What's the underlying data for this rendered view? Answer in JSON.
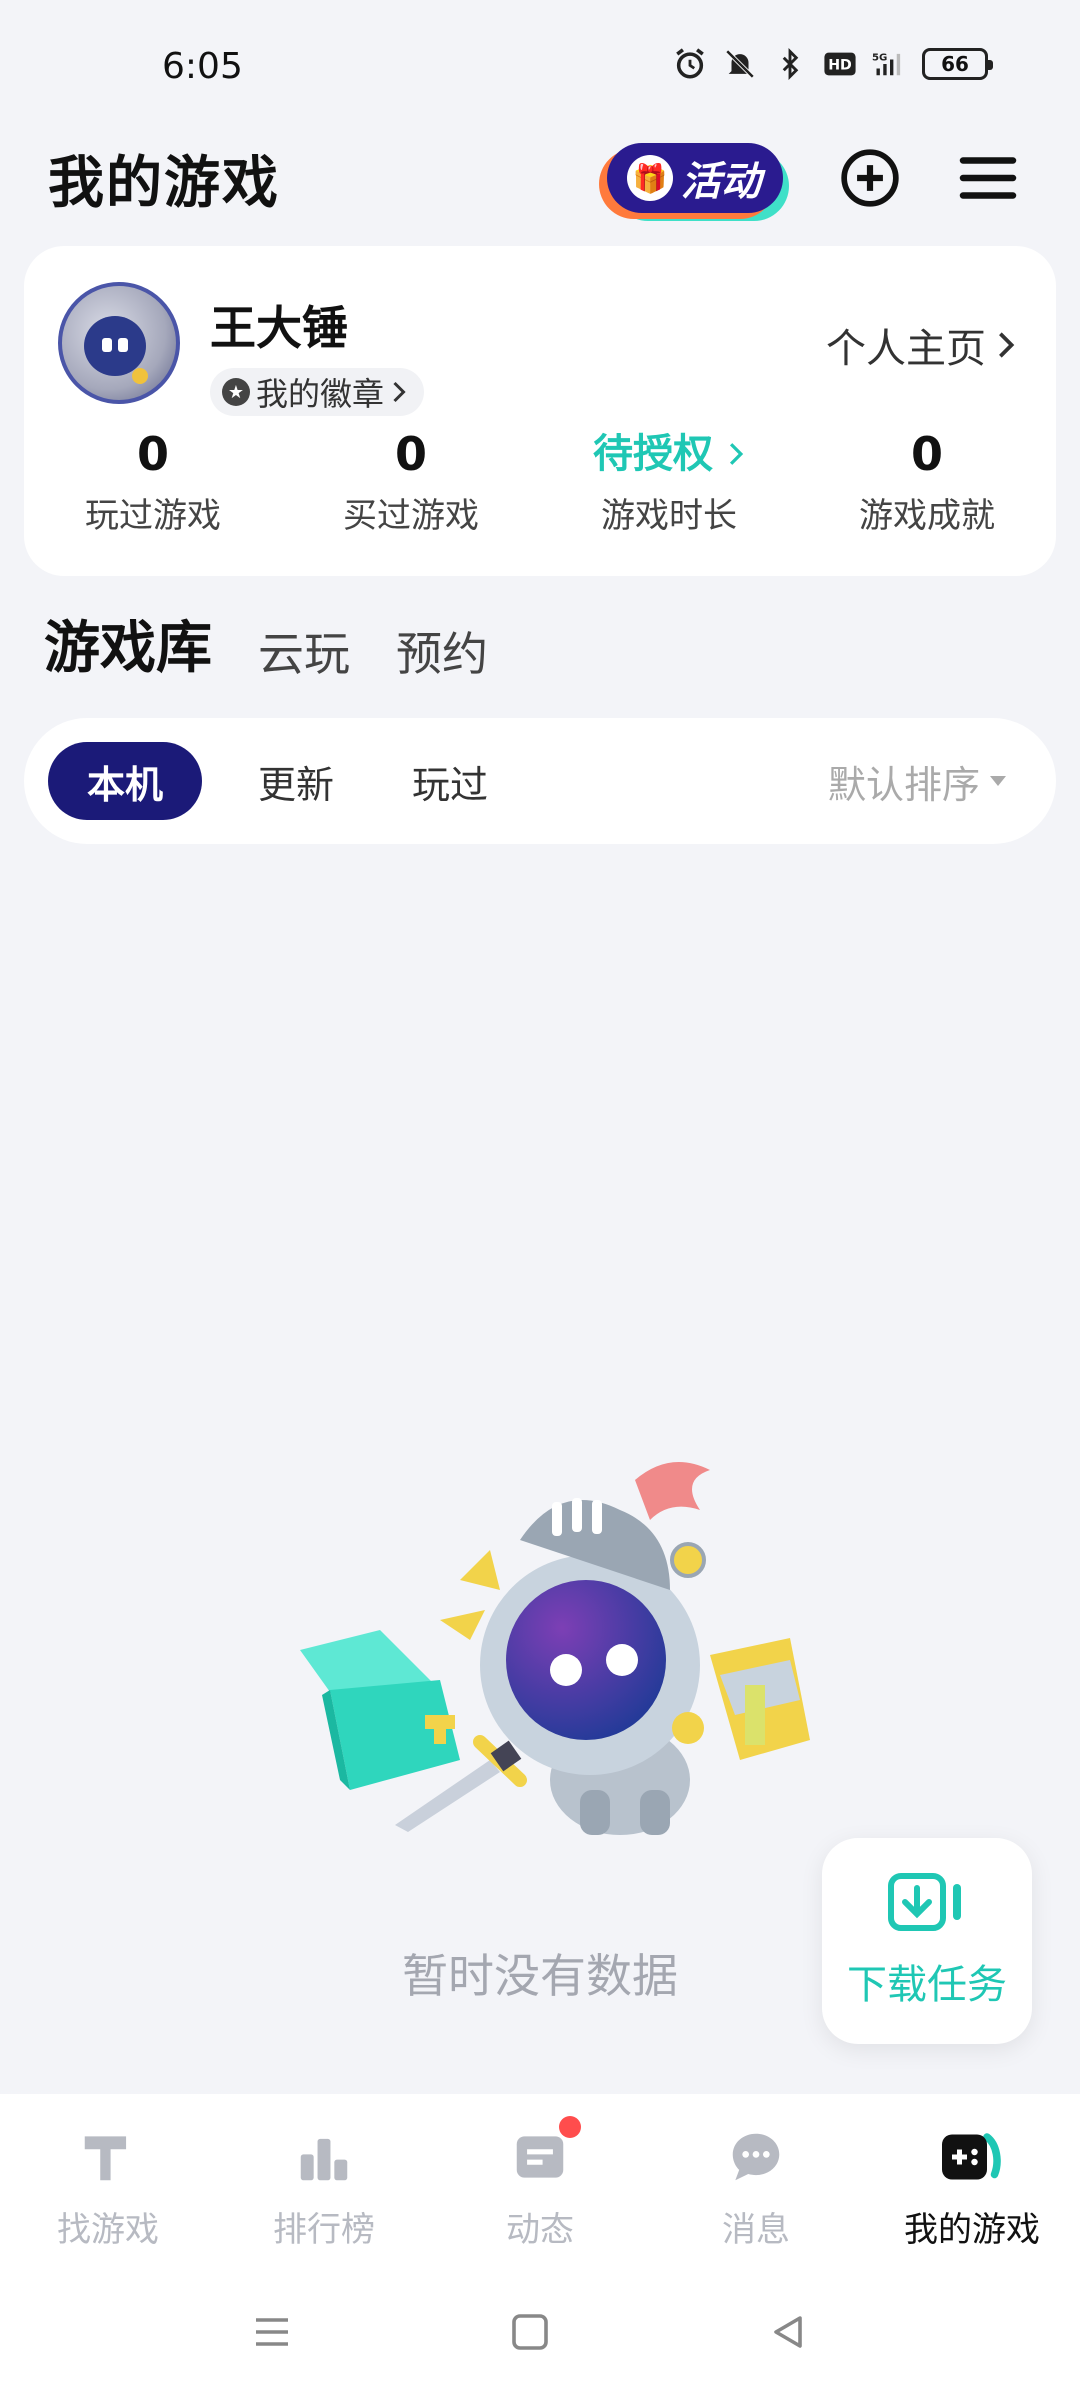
{
  "status": {
    "time": "6:05",
    "battery": "66",
    "network": "5G"
  },
  "header": {
    "title": "我的游戏",
    "activity_label": "活动"
  },
  "profile": {
    "username": "王大锤",
    "badge_label": "我的徽章",
    "homepage_label": "个人主页",
    "stats": [
      {
        "value": "0",
        "label": "玩过游戏"
      },
      {
        "value": "0",
        "label": "买过游戏"
      },
      {
        "value": "待授权",
        "label": "游戏时长"
      },
      {
        "value": "0",
        "label": "游戏成就"
      }
    ]
  },
  "library_tabs": [
    "游戏库",
    "云玩",
    "预约"
  ],
  "filters": {
    "local": "本机",
    "update": "更新",
    "played": "玩过",
    "sort": "默认排序"
  },
  "empty_state": {
    "text": "暂时没有数据"
  },
  "download": {
    "label": "下载任务"
  },
  "bottom_nav": [
    {
      "label": "找游戏",
      "icon": "hammer-icon"
    },
    {
      "label": "排行榜",
      "icon": "ranking-icon"
    },
    {
      "label": "动态",
      "icon": "feed-icon"
    },
    {
      "label": "消息",
      "icon": "chat-icon"
    },
    {
      "label": "我的游戏",
      "icon": "gamepad-icon"
    }
  ],
  "colors": {
    "accent": "#1fc7b4",
    "primary": "#1b1a78",
    "background": "#f3f4f8"
  }
}
